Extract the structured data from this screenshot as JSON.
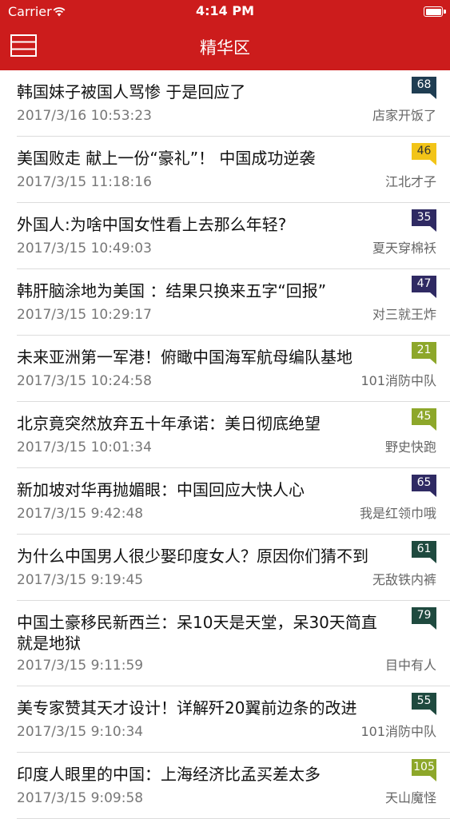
{
  "status_bar": {
    "carrier": "Carrier",
    "time": "4:14 PM"
  },
  "nav": {
    "title": "精华区",
    "menu_icon": "menu-icon"
  },
  "articles": [
    {
      "title": "韩国妹子被国人骂惨 于是回应了",
      "date": "2017/3/16 10:53:23",
      "author": "店家开饭了",
      "count": "68",
      "color": "#1f3d52"
    },
    {
      "title": "美国败走 献上一份“豪礼”！ 中国成功逆袭",
      "date": "2017/3/15 11:18:16",
      "author": "江北才子",
      "count": "46",
      "color": "#f2c418",
      "text_color": "#333333"
    },
    {
      "title": "外国人:为啥中国女性看上去那么年轻?",
      "date": "2017/3/15 10:49:03",
      "author": "夏天穿棉袄",
      "count": "35",
      "color": "#2f2a63"
    },
    {
      "title": "韩肝脑涂地为美国 ：结果只换来五字“回报”",
      "date": "2017/3/15 10:29:17",
      "author": "对三就王炸",
      "count": "47",
      "color": "#2f2a63"
    },
    {
      "title": "未来亚洲第一军港！俯瞰中国海军航母编队基地",
      "date": "2017/3/15 10:24:58",
      "author": "101消防中队",
      "count": "21",
      "color": "#8da72a"
    },
    {
      "title": "北京竟突然放弃五十年承诺：美日彻底绝望",
      "date": "2017/3/15 10:01:34",
      "author": "野史快跑",
      "count": "45",
      "color": "#8da72a"
    },
    {
      "title": "新加坡对华再抛媚眼：中国回应大快人心",
      "date": "2017/3/15 9:42:48",
      "author": "我是红领巾哦",
      "count": "65",
      "color": "#2f2a63"
    },
    {
      "title": "为什么中国男人很少娶印度女人？原因你们猜不到",
      "date": "2017/3/15 9:19:45",
      "author": "无敌铁内裤",
      "count": "61",
      "color": "#1f4a3f"
    },
    {
      "title": "中国土豪移民新西兰：呆10天是天堂，呆30天简直就是地狱",
      "date": "2017/3/15 9:11:59",
      "author": "目中有人",
      "count": "79",
      "color": "#1f4a3f"
    },
    {
      "title": "美专家赞其天才设计！详解歼20翼前边条的改进",
      "date": "2017/3/15 9:10:34",
      "author": "101消防中队",
      "count": "55",
      "color": "#1f4a3f"
    },
    {
      "title": "印度人眼里的中国：上海经济比孟买差太多",
      "date": "2017/3/15 9:09:58",
      "author": "天山魔怪",
      "count": "105",
      "color": "#8da72a"
    }
  ]
}
